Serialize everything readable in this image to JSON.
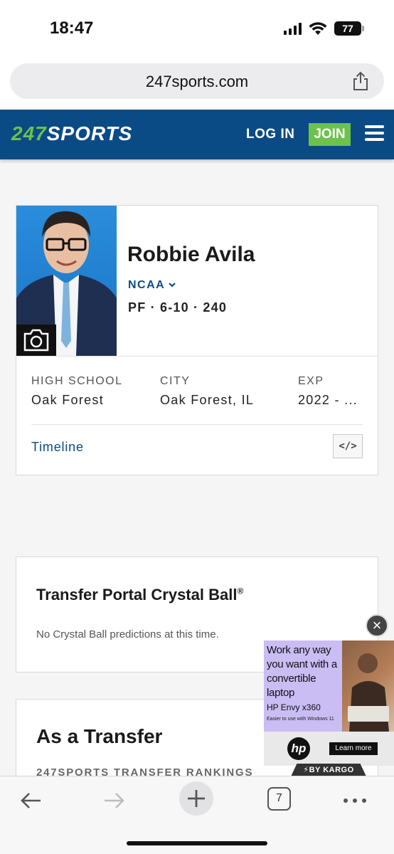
{
  "status_bar": {
    "time": "18:47",
    "battery": "77"
  },
  "browser": {
    "url": "247sports.com",
    "tabs_count": "7"
  },
  "header": {
    "logo_num": "247",
    "logo_text": "SPORTS",
    "login": "LOG IN",
    "join": "JOIN",
    "colors": {
      "brand": "#0a4b86",
      "accent": "#6cc24a"
    }
  },
  "profile": {
    "name": "Robbie Avila",
    "league": "NCAA",
    "position_info": "PF · 6-10 · 240",
    "high_school_label": "HIGH SCHOOL",
    "high_school": "Oak Forest",
    "city_label": "CITY",
    "city": "Oak Forest, IL",
    "exp_label": "EXP",
    "exp": "2022 - ...",
    "timeline": "Timeline",
    "embed": "</>"
  },
  "crystal_ball": {
    "title": "Transfer Portal Crystal Ball",
    "trademark": "®",
    "empty_message": "No Crystal Ball predictions at this time."
  },
  "transfer": {
    "title": "As a Transfer",
    "subtitle": "247SPORTS TRANSFER RANKINGS"
  },
  "ad": {
    "headline": "Work any way you want with a convertible laptop",
    "product": "HP Envy x360",
    "note": "Easier to use with Windows 11",
    "brand": "hp",
    "cta": "Learn more",
    "attribution": "⚡BY KARGO"
  }
}
